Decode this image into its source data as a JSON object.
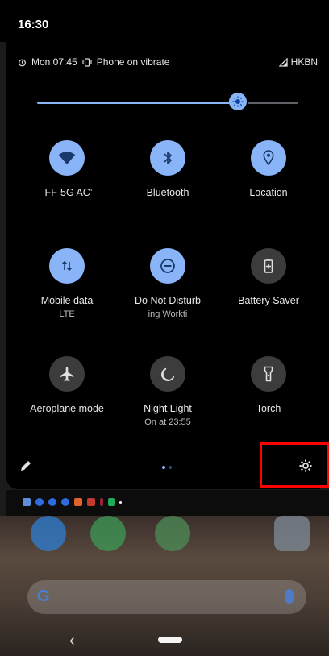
{
  "status_bar": {
    "time": "16:30"
  },
  "info_row": {
    "alarm": "Mon 07:45",
    "vibrate": "Phone on vibrate",
    "carrier": "HKBN"
  },
  "brightness": {
    "level": 0.77
  },
  "tiles": [
    {
      "label": "-FF-5G        AC’",
      "sub": "",
      "icon": "wifi-icon",
      "active": true
    },
    {
      "label": "Bluetooth",
      "sub": "",
      "icon": "bluetooth-icon",
      "active": true
    },
    {
      "label": "Location",
      "sub": "",
      "icon": "location-icon",
      "active": true
    },
    {
      "label": "Mobile data",
      "sub": "LTE",
      "icon": "mobile-data-icon",
      "active": true
    },
    {
      "label": "Do Not Disturb",
      "sub": "ing        Workti",
      "icon": "do-not-disturb-icon",
      "active": true
    },
    {
      "label": "Battery Saver",
      "sub": "",
      "icon": "battery-saver-icon",
      "active": false
    },
    {
      "label": "Aeroplane mode",
      "sub": "",
      "icon": "aeroplane-icon",
      "active": false
    },
    {
      "label": "Night Light",
      "sub": "On at 23:55",
      "icon": "night-light-icon",
      "active": false
    },
    {
      "label": "Torch",
      "sub": "",
      "icon": "torch-icon",
      "active": false
    }
  ],
  "pager": {
    "pages": 2,
    "current": 1
  },
  "colors": {
    "accent": "#8ab4f8",
    "tile_off": "#3c3c3c",
    "highlight": "#ff0000"
  }
}
